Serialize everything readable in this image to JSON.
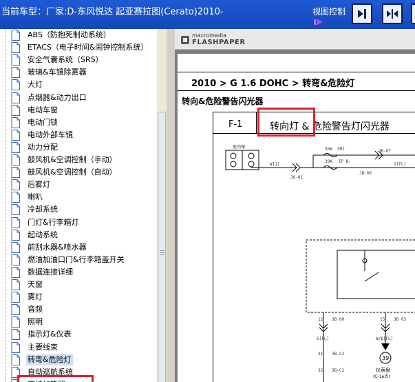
{
  "topbar": {
    "vehicle_title": "当前车型：厂家:D-东风悦达 起亚赛拉图(Cerato)2010-",
    "view_control_label": "视图控制"
  },
  "tree": {
    "items": [
      {
        "label": "ABS（防抱死制动系统）"
      },
      {
        "label": "ETACS（电子时间&闹钟控制系统）"
      },
      {
        "label": "安全气囊系统（SRS）"
      },
      {
        "label": "玻璃&车镜除雾器"
      },
      {
        "label": "大灯"
      },
      {
        "label": "点烟器&动力出口"
      },
      {
        "label": "电动车窗"
      },
      {
        "label": "电动门锁"
      },
      {
        "label": "电动外部车镜"
      },
      {
        "label": "动力分配"
      },
      {
        "label": "鼓风机&空调控制（手动）"
      },
      {
        "label": "鼓风机&空调控制（自动）"
      },
      {
        "label": "后雾灯"
      },
      {
        "label": "喇叭"
      },
      {
        "label": "冷却系统"
      },
      {
        "label": "门灯&行李箱灯"
      },
      {
        "label": "起动系统"
      },
      {
        "label": "前刮水器&喷水器"
      },
      {
        "label": "燃油加油口门&行李箱盖开关"
      },
      {
        "label": "数据连接详细"
      },
      {
        "label": "天窗"
      },
      {
        "label": "雾灯"
      },
      {
        "label": "音频"
      },
      {
        "label": "照明"
      },
      {
        "label": "指示灯&仪表"
      },
      {
        "label": "主要线束"
      },
      {
        "label": "转弯&危险灯",
        "selected": true
      },
      {
        "label": "自动巡航系统"
      },
      {
        "label": "座椅加热器"
      }
    ]
  },
  "viewer": {
    "brand_top": "macromedia",
    "brand_bottom": "FLASHPAPER",
    "breadcrumb": "2010 > G 1.6 DOHC > 转弯&危险灯",
    "section_title": "转向&危险警告闪光器",
    "figure": {
      "id": "F-1",
      "title": "转向灯 & 危险警告灯闪光器"
    },
    "wiring_labels": {
      "fuse_box": "室内保",
      "wire1": "W[1]",
      "wire2": "J6-01",
      "fuse1": "30A",
      "fuse1b": "SM1",
      "fuse2": "30A",
      "fuse2b": "IP B-",
      "conn1": "JB-07",
      "conn2": "JB-06",
      "wire3": "G[FL]",
      "pin1": "12",
      "pin1b": "JB 00",
      "pin2": "15",
      "pin2b": "JB 03",
      "wire4": "G[FL]",
      "wire5": "W/B[FL]",
      "conn3": "JB-C3",
      "conn4": "JB-C2",
      "pin3": "31",
      "pin4": "32",
      "ground_num": "39",
      "ground_label": "仪表盘",
      "ground_sub": "(C-1e点)"
    }
  }
}
